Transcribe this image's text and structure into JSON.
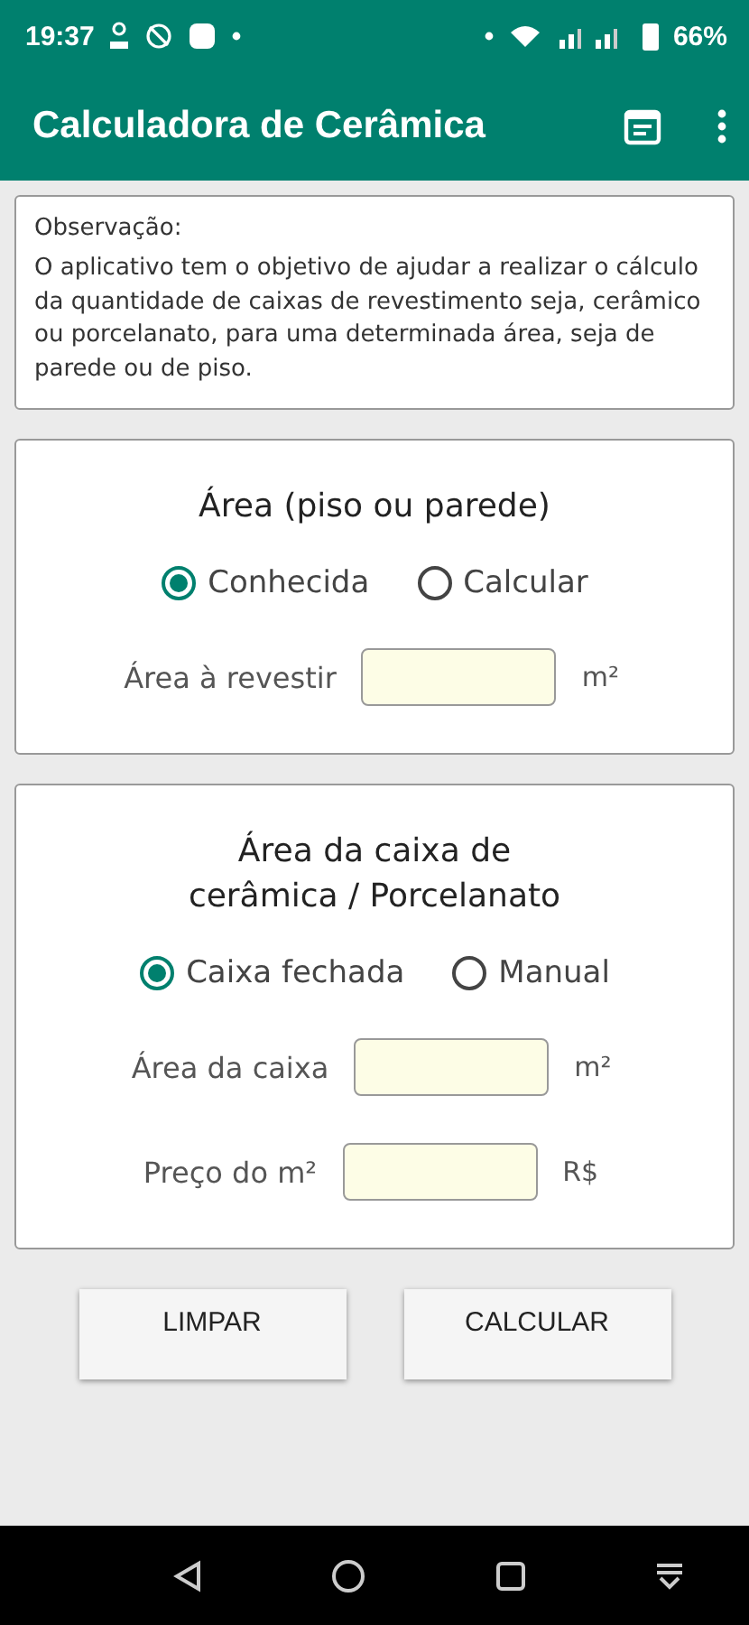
{
  "status_bar": {
    "time": "19:37",
    "battery": "66%"
  },
  "app_bar": {
    "title": "Calculadora de Cerâmica"
  },
  "note": {
    "title": "Observação:",
    "text": "O aplicativo tem o objetivo de ajudar a realizar o cálculo da quantidade de caixas de revestimento seja, cerâmico ou porcelanato, para uma determinada área, seja de parede ou de piso."
  },
  "sections": [
    {
      "title": "Área (piso ou parede)",
      "options": [
        {
          "label": "Conhecida",
          "selected": true
        },
        {
          "label": "Calcular",
          "selected": false
        }
      ],
      "fields": [
        {
          "label": "Área à revestir",
          "unit": "m²"
        }
      ]
    },
    {
      "title": "Área da caixa de\ncerâmica / Porcelanato",
      "options": [
        {
          "label": "Caixa fechada",
          "selected": true
        },
        {
          "label": "Manual",
          "selected": false
        }
      ],
      "fields": [
        {
          "label": "Área da caixa",
          "unit": "m²"
        },
        {
          "label": "Preço do m²",
          "unit": "R$"
        }
      ]
    }
  ],
  "buttons": [
    "LIMPAR",
    "CALCULAR"
  ]
}
